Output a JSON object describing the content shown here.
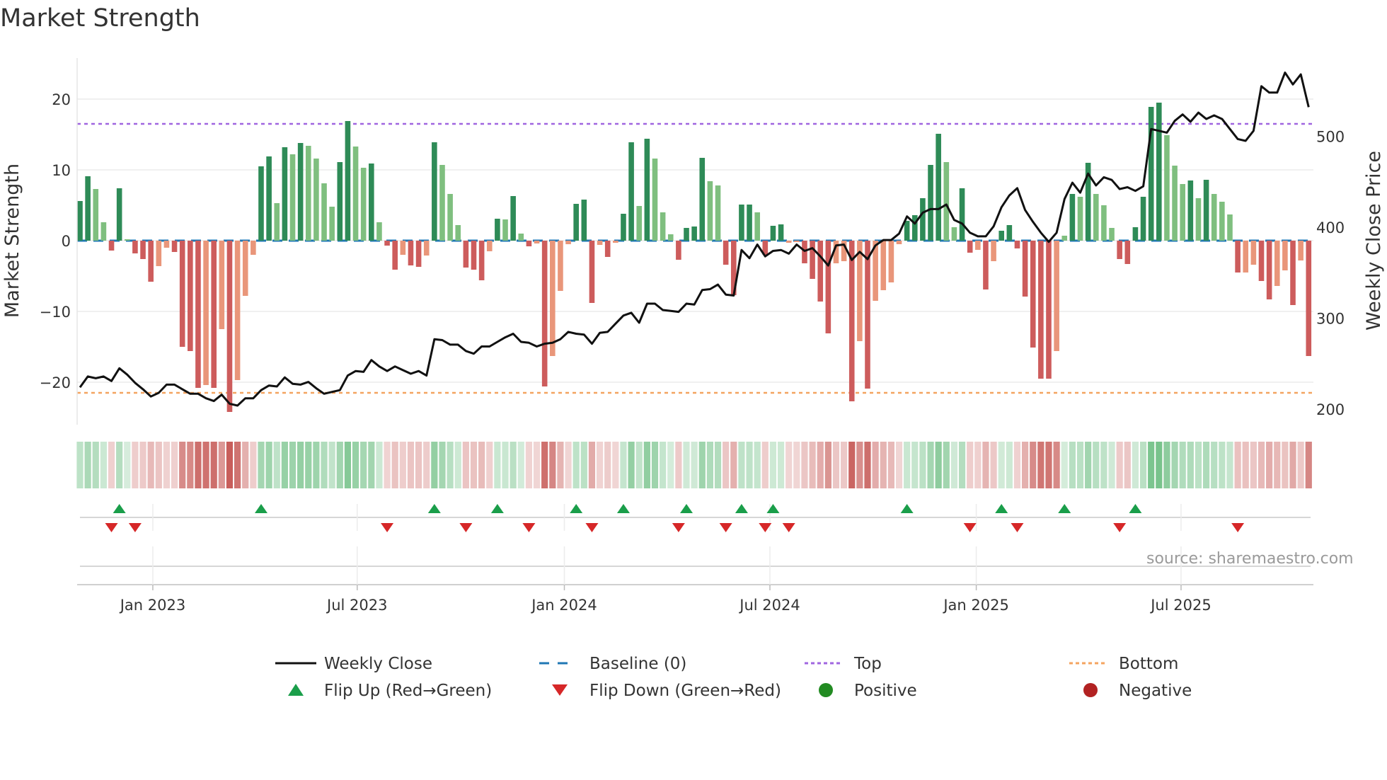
{
  "title": "Market Strength",
  "source": "source: sharemaestro.com",
  "colors": {
    "pos_dark": "#2e8b57",
    "pos_light": "#7fbf7f",
    "neg_dark": "#cd5c5c",
    "neg_light": "#e9967a",
    "close": "#111111",
    "baseline": "#1f77b4",
    "top": "#a066e0",
    "bottom": "#f4a460",
    "flip_up": "#1a9e4a",
    "flip_down": "#d62728",
    "positive": "#228b22",
    "negative": "#b22222"
  },
  "legend": [
    {
      "label": "Weekly Close",
      "icon": "solid-line"
    },
    {
      "label": "Baseline (0)",
      "icon": "dashed-line"
    },
    {
      "label": "Top",
      "icon": "dotted-line"
    },
    {
      "label": "Bottom",
      "icon": "dotted-line"
    },
    {
      "label": "Flip Up (Red→Green)",
      "icon": "triangle-up"
    },
    {
      "label": "Flip Down (Green→Red)",
      "icon": "triangle-down"
    },
    {
      "label": "Positive",
      "icon": "circle"
    },
    {
      "label": "Negative",
      "icon": "circle"
    }
  ],
  "chart_data": {
    "type": "bar",
    "title": "Market Strength",
    "ylabel": "Market Strength",
    "y2label": "Weekly Close Price",
    "ylim": [
      -26,
      25.8
    ],
    "y2lim": [
      183,
      586
    ],
    "yticks": [
      {
        "v": 20,
        "label": "20"
      },
      {
        "v": 10,
        "label": "10"
      },
      {
        "v": 0,
        "label": "0"
      },
      {
        "v": -10,
        "label": "−10"
      },
      {
        "v": -20,
        "label": "−20"
      }
    ],
    "y2ticks": [
      {
        "v": 500,
        "label": "500"
      },
      {
        "v": 400,
        "label": "400"
      },
      {
        "v": 300,
        "label": "300"
      },
      {
        "v": 200,
        "label": "200"
      }
    ],
    "xticks": [
      {
        "label": "Jan 2023",
        "week": 9.25
      },
      {
        "label": "Jul 2023",
        "week": 35.2
      },
      {
        "label": "Jan 2024",
        "week": 61.5
      },
      {
        "label": "Jul 2024",
        "week": 87.6
      },
      {
        "label": "Jan 2025",
        "week": 113.8
      },
      {
        "label": "Jul 2025",
        "week": 139.8
      }
    ],
    "top_level": 16.5,
    "bottom_level": -21.5,
    "strength": [
      5.6,
      9.1,
      7.3,
      2.6,
      -1.4,
      7.4,
      0.2,
      -1.8,
      -2.6,
      -5.8,
      -3.6,
      -1.0,
      -1.6,
      -15.0,
      -15.6,
      -20.8,
      -20.4,
      -20.8,
      -12.5,
      -24.2,
      -19.7,
      -7.8,
      -2.0,
      10.5,
      11.9,
      5.3,
      13.2,
      12.2,
      13.8,
      13.4,
      11.6,
      8.1,
      4.8,
      11.1,
      16.9,
      13.3,
      10.3,
      10.9,
      2.6,
      -0.7,
      -4.1,
      -2.0,
      -3.5,
      -3.7,
      -2.1,
      13.9,
      10.7,
      6.6,
      2.2,
      -3.8,
      -4.1,
      -5.6,
      -1.5,
      3.1,
      3.0,
      6.3,
      1.0,
      -0.8,
      -0.4,
      -20.6,
      -16.3,
      -7.1,
      -0.5,
      5.2,
      5.8,
      -8.8,
      -0.6,
      -2.3,
      -0.3,
      3.8,
      13.9,
      4.9,
      14.4,
      11.6,
      4.0,
      0.9,
      -2.7,
      1.8,
      2.0,
      11.7,
      8.4,
      7.8,
      -3.4,
      -7.7,
      5.1,
      5.1,
      4.0,
      -2.0,
      2.1,
      2.3,
      -0.3,
      -0.2,
      -3.2,
      -5.4,
      -8.6,
      -13.1,
      -3.2,
      -2.9,
      -22.7,
      -14.2,
      -20.9,
      -8.5,
      -7.0,
      -5.9,
      -0.5,
      2.8,
      3.6,
      6.0,
      10.7,
      15.1,
      11.1,
      1.9,
      7.4,
      -1.7,
      -1.3,
      -6.9,
      -2.9,
      1.4,
      2.2,
      -1.1,
      -7.9,
      -15.1,
      -19.5,
      -19.5,
      -15.6,
      0.7,
      6.6,
      6.2,
      11.0,
      6.6,
      5.0,
      1.8,
      -2.6,
      -3.3,
      1.9,
      6.2,
      18.9,
      19.5,
      14.9,
      10.6,
      8.0,
      8.5,
      6.0,
      8.6,
      6.6,
      5.5,
      3.7,
      -4.5,
      -4.5,
      -3.4,
      -5.7,
      -8.3,
      -6.4,
      -4.2,
      -9.1,
      -2.8,
      -16.3
    ],
    "strength_rising": [
      1,
      1,
      0,
      0,
      1,
      1,
      0,
      1,
      1,
      1,
      0,
      0,
      1,
      1,
      1,
      1,
      0,
      1,
      0,
      1,
      0,
      0,
      0,
      1,
      1,
      0,
      1,
      0,
      1,
      0,
      0,
      0,
      0,
      1,
      1,
      0,
      0,
      1,
      0,
      1,
      1,
      0,
      1,
      1,
      0,
      1,
      0,
      0,
      0,
      1,
      1,
      1,
      0,
      1,
      0,
      1,
      0,
      1,
      0,
      1,
      0,
      0,
      0,
      1,
      1,
      1,
      0,
      1,
      0,
      1,
      1,
      0,
      1,
      0,
      0,
      0,
      1,
      1,
      1,
      1,
      0,
      0,
      1,
      1,
      1,
      1,
      0,
      1,
      1,
      1,
      0,
      0,
      1,
      1,
      1,
      1,
      0,
      0,
      1,
      0,
      1,
      0,
      0,
      0,
      0,
      1,
      1,
      1,
      1,
      1,
      0,
      0,
      1,
      1,
      0,
      1,
      0,
      1,
      1,
      1,
      1,
      1,
      1,
      1,
      0,
      0,
      1,
      0,
      1,
      0,
      0,
      0,
      1,
      1,
      1,
      1,
      1,
      1,
      0,
      0,
      0,
      1,
      0,
      1,
      0,
      0,
      0,
      1,
      0,
      0,
      1,
      1,
      0,
      0,
      1,
      0,
      1
    ],
    "close": [
      224,
      236,
      234,
      236,
      231,
      245,
      238,
      229,
      222,
      214,
      218,
      227,
      227,
      222,
      217,
      217,
      212,
      209,
      216,
      206,
      204,
      212,
      212,
      221,
      226,
      225,
      235,
      228,
      227,
      230,
      223,
      217,
      219,
      221,
      237,
      242,
      241,
      254,
      247,
      242,
      247,
      243,
      239,
      242,
      237,
      277,
      276,
      271,
      271,
      264,
      261,
      269,
      269,
      274,
      279,
      283,
      274,
      273,
      269,
      272,
      273,
      277,
      285,
      283,
      282,
      272,
      284,
      285,
      294,
      303,
      306,
      295,
      316,
      316,
      309,
      308,
      307,
      316,
      315,
      331,
      332,
      337,
      326,
      325,
      375,
      366,
      381,
      368,
      374,
      375,
      371,
      381,
      374,
      377,
      368,
      358,
      380,
      381,
      364,
      373,
      365,
      380,
      386,
      386,
      393,
      412,
      404,
      416,
      420,
      420,
      425,
      408,
      404,
      394,
      390,
      390,
      401,
      422,
      435,
      443,
      419,
      406,
      394,
      384,
      394,
      431,
      449,
      438,
      459,
      446,
      455,
      452,
      442,
      444,
      440,
      445,
      508,
      506,
      504,
      517,
      524,
      516,
      526,
      519,
      523,
      519,
      508,
      497,
      495,
      506,
      555,
      548,
      548,
      570,
      557,
      568,
      532
    ],
    "flip_up_weeks": [
      5,
      23,
      45,
      53,
      63,
      69,
      77,
      84,
      88,
      105,
      117,
      125,
      134
    ],
    "flip_down_weeks": [
      4,
      7,
      39,
      49,
      57,
      65,
      76,
      82,
      87,
      90,
      113,
      119,
      132,
      147
    ]
  }
}
